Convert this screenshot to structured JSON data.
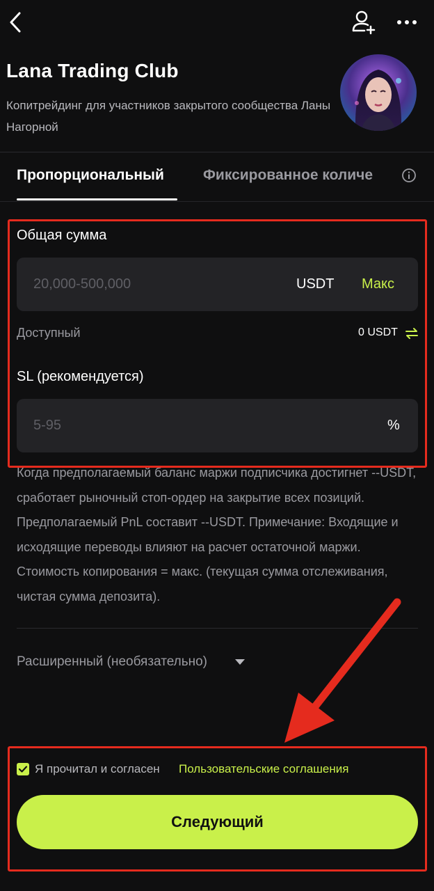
{
  "header": {
    "title": "Lana Trading Club",
    "subtitle": "Копитрейдинг для участников закрытого сообщества Ланы Нагорной"
  },
  "tabs": [
    {
      "label": "Пропорциональный",
      "active": true
    },
    {
      "label": "Фиксированное количе",
      "active": false
    }
  ],
  "form": {
    "total": {
      "label": "Общая сумма",
      "placeholder": "20,000-500,000",
      "unit": "USDT",
      "max_label": "Макс"
    },
    "available": {
      "label": "Доступный",
      "value": "0 USDT"
    },
    "sl": {
      "label": "SL (рекомендуется)",
      "placeholder": "5-95",
      "unit": "%"
    },
    "note": "Когда предполагаемый баланс маржи подписчика достигнет --USDT, сработает рыночный стоп-ордер на закрытие всех позиций. Предполагаемый PnL составит --USDT. Примечание: Входящие и исходящие переводы влияют на расчет остаточной маржи. Стоимость копирования = макс. (текущая сумма отслеживания, чистая сумма депозита)."
  },
  "advanced": {
    "label": "Расширенный (необязательно)"
  },
  "agreement": {
    "checked": true,
    "text": "Я прочитал и согласен",
    "link": "Пользовательские соглашения"
  },
  "next_button": {
    "label": "Следующий"
  },
  "colors": {
    "accent": "#c9f04a",
    "background": "#0f0f10",
    "input_bg": "#232326",
    "annotation": "#e52b1e"
  },
  "icons": [
    "back-icon",
    "add-user-icon",
    "more-icon",
    "info-icon",
    "swap-icon",
    "caret-down-icon",
    "check-icon"
  ]
}
